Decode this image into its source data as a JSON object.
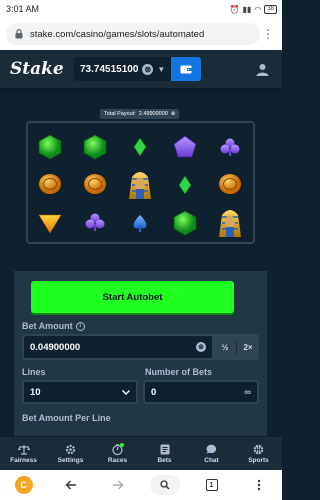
{
  "statusbar": {
    "time": "3:01 AM",
    "battery": "38"
  },
  "browser": {
    "url": "stake.com/casino/games/slots/automated",
    "tab_count": "1"
  },
  "header": {
    "logo": "Stake",
    "balance": "73.74515100"
  },
  "game": {
    "total_payout_label": "Total Payout:",
    "total_payout_value": "2.49900000"
  },
  "controls": {
    "start_button": "Start Autobet",
    "bet_amount_label": "Bet Amount",
    "bet_amount_value": "0.04900000",
    "half_label": "½",
    "double_label": "2×",
    "lines_label": "Lines",
    "lines_value": "10",
    "bets_label": "Number of Bets",
    "bets_value": "0",
    "infinity_label": "∞",
    "per_line_label": "Bet Amount Per Line"
  },
  "nav": [
    {
      "label": "Fairness",
      "icon": "scale-icon"
    },
    {
      "label": "Settings",
      "icon": "gear-icon"
    },
    {
      "label": "Races",
      "icon": "races-icon"
    },
    {
      "label": "Bets",
      "icon": "bets-icon"
    },
    {
      "label": "Chat",
      "icon": "chat-icon"
    },
    {
      "label": "Sports",
      "icon": "basketball-icon"
    }
  ],
  "colors": {
    "accent_green": "#1fff20",
    "wallet_blue": "#1475e1",
    "bg_dark": "#0f212e",
    "panel": "#213743"
  }
}
